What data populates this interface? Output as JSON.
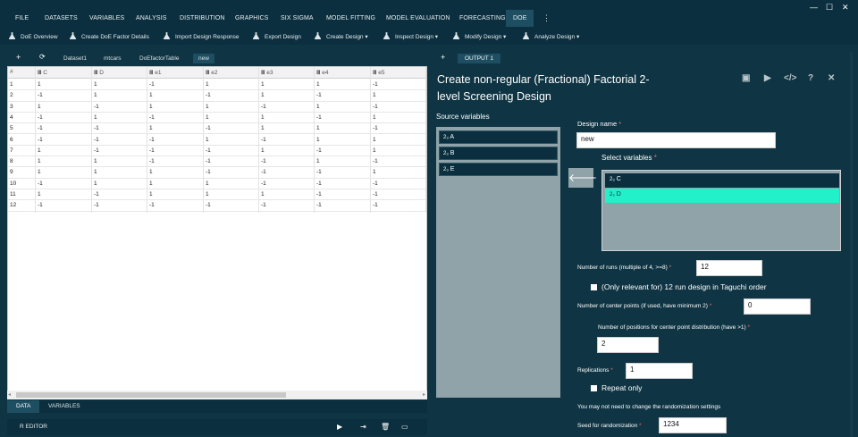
{
  "menu": {
    "items": [
      "FILE",
      "DATASETS",
      "VARIABLES",
      "ANALYSIS",
      "DISTRIBUTION",
      "GRAPHICS",
      "SIX SIGMA",
      "MODEL FITTING",
      "MODEL EVALUATION",
      "FORECASTING",
      "DOE"
    ],
    "more": "⋮"
  },
  "window": {
    "minimize": "—",
    "maximize": "☐",
    "close": "✕"
  },
  "toolbar": {
    "items": [
      "DoE Overview",
      "Create DoE Factor Details",
      "Import Design Response",
      "Export Design",
      "Create Design ▾",
      "Inspect Design ▾",
      "Modify Design ▾",
      "Analyze Design ▾"
    ]
  },
  "datasets": {
    "add": "+",
    "refresh": "⟳",
    "tabs": [
      "Dataset1",
      "mtcars",
      "DoEfactorTable",
      "new"
    ]
  },
  "grid": {
    "columns": [
      "#",
      "C",
      "D",
      "e1",
      "e2",
      "e3",
      "e4",
      "e5"
    ],
    "rows": [
      [
        "1",
        "1",
        "1",
        "-1",
        "1",
        "1",
        "1",
        "-1"
      ],
      [
        "2",
        "-1",
        "1",
        "1",
        "-1",
        "1",
        "-1",
        "1"
      ],
      [
        "3",
        "1",
        "-1",
        "1",
        "1",
        "-1",
        "1",
        "-1"
      ],
      [
        "4",
        "-1",
        "1",
        "-1",
        "1",
        "1",
        "-1",
        "1"
      ],
      [
        "5",
        "-1",
        "-1",
        "1",
        "-1",
        "1",
        "1",
        "-1"
      ],
      [
        "6",
        "-1",
        "-1",
        "-1",
        "1",
        "-1",
        "1",
        "1"
      ],
      [
        "7",
        "1",
        "-1",
        "-1",
        "-1",
        "1",
        "-1",
        "1"
      ],
      [
        "8",
        "1",
        "1",
        "-1",
        "-1",
        "-1",
        "1",
        "-1"
      ],
      [
        "9",
        "1",
        "1",
        "1",
        "-1",
        "-1",
        "-1",
        "1"
      ],
      [
        "10",
        "-1",
        "1",
        "1",
        "1",
        "-1",
        "-1",
        "-1"
      ],
      [
        "11",
        "1",
        "-1",
        "1",
        "1",
        "1",
        "-1",
        "-1"
      ],
      [
        "12",
        "-1",
        "-1",
        "-1",
        "-1",
        "-1",
        "-1",
        "-1"
      ]
    ]
  },
  "bottom": {
    "tabs": [
      "DATA",
      "VARIABLES"
    ],
    "reditor": "R EDITOR"
  },
  "output": {
    "add": "+",
    "tab": "OUTPUT 1"
  },
  "dialog": {
    "title_line1": "Create non-regular (Fractional) Factorial 2-",
    "title_line2": "level Screening Design",
    "source_label": "Source variables",
    "source_vars": [
      "A",
      "B",
      "E"
    ],
    "var_icon": "2₃",
    "design_name_label": "Design name",
    "design_name": "new",
    "select_label": "Select variables",
    "selected_vars": [
      "C",
      "D"
    ],
    "runs_label": "Number of runs (multiple of 4, >=8)",
    "runs": "12",
    "taguchi_label": "(Only relevant for) 12 run design in Taguchi order",
    "center_label": "Number of center points (if used, have minimum 2)",
    "center": "0",
    "positions_label": "Number of positions for center point distribution (have >1)",
    "positions": "2",
    "replications_label": "Replications",
    "replications": "1",
    "repeat_label": "Repeat only",
    "randomization_note": "You may not need to change the randomization settings",
    "seed_label": "Seed for randomization",
    "seed": "1234"
  }
}
